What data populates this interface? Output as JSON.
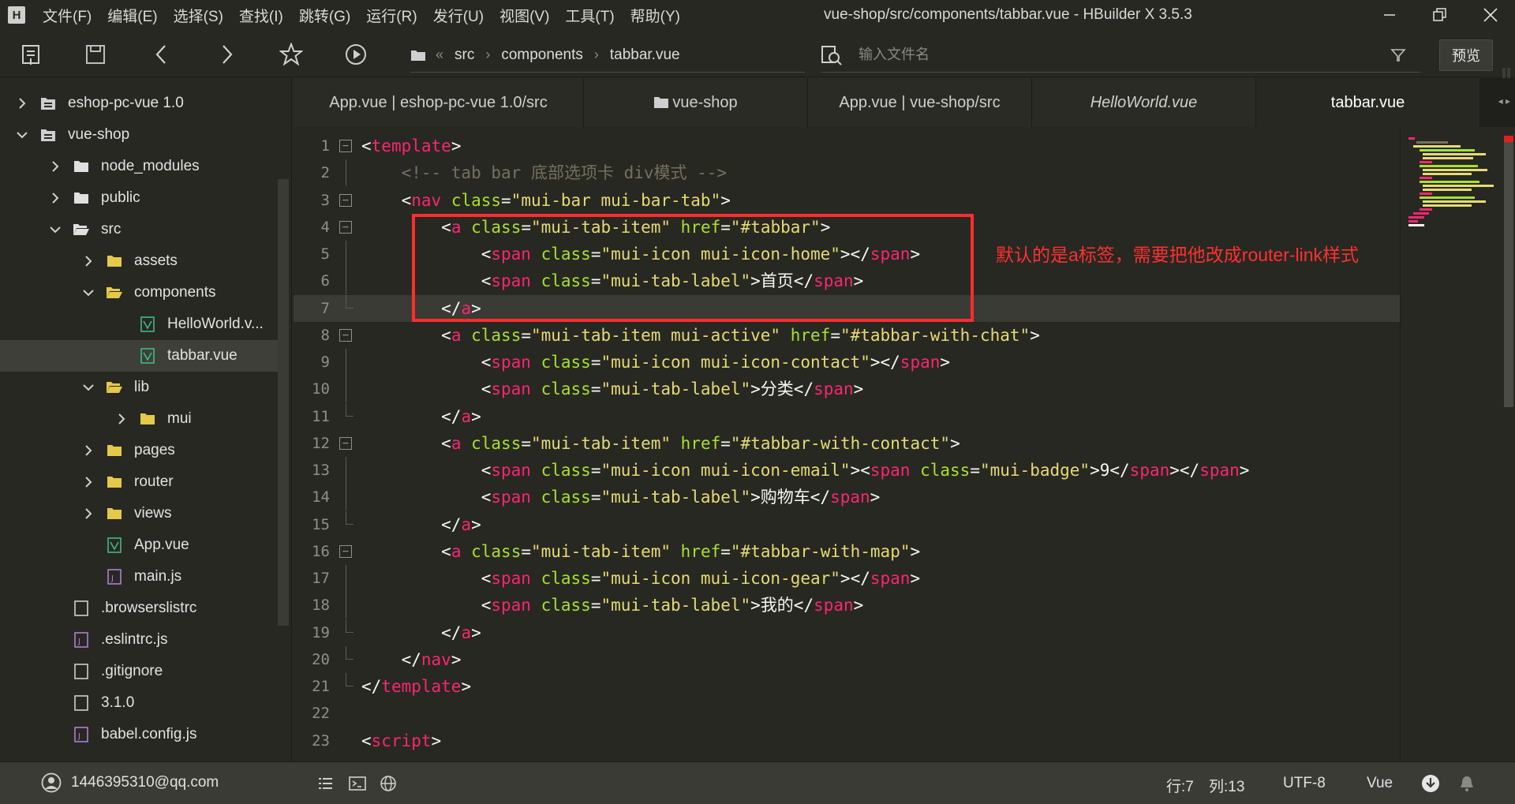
{
  "window": {
    "title": "vue-shop/src/components/tabbar.vue - HBuilder X 3.5.3"
  },
  "menu": [
    "文件(F)",
    "编辑(E)",
    "选择(S)",
    "查找(I)",
    "跳转(G)",
    "运行(R)",
    "发行(U)",
    "视图(V)",
    "工具(T)",
    "帮助(Y)"
  ],
  "breadcrumb": [
    "src",
    "components",
    "tabbar.vue"
  ],
  "search": {
    "placeholder": "输入文件名"
  },
  "toolbar": {
    "preview": "预览"
  },
  "sidebar": {
    "items": [
      {
        "label": "eshop-pc-vue 1.0"
      },
      {
        "label": "vue-shop"
      },
      {
        "label": "node_modules"
      },
      {
        "label": "public"
      },
      {
        "label": "src"
      },
      {
        "label": "assets"
      },
      {
        "label": "components"
      },
      {
        "label": "HelloWorld.v..."
      },
      {
        "label": "tabbar.vue"
      },
      {
        "label": "lib"
      },
      {
        "label": "mui"
      },
      {
        "label": "pages"
      },
      {
        "label": "router"
      },
      {
        "label": "views"
      },
      {
        "label": "App.vue"
      },
      {
        "label": "main.js"
      },
      {
        "label": ".browserslistrc"
      },
      {
        "label": ".eslintrc.js"
      },
      {
        "label": ".gitignore"
      },
      {
        "label": "3.1.0"
      },
      {
        "label": "babel.config.js"
      }
    ]
  },
  "tabs": [
    {
      "label": "App.vue | eshop-pc-vue 1.0/src"
    },
    {
      "label": "vue-shop"
    },
    {
      "label": "App.vue | vue-shop/src"
    },
    {
      "label": "HelloWorld.vue"
    },
    {
      "label": "tabbar.vue"
    }
  ],
  "editor": {
    "current_line": 7,
    "lines": [
      {
        "n": "1",
        "fold": "open",
        "tokens": [
          [
            "p",
            "<"
          ],
          [
            "t",
            "template"
          ],
          [
            "p",
            ">"
          ]
        ]
      },
      {
        "n": "2",
        "tokens": [
          [
            "s",
            "    "
          ],
          [
            "c",
            "<!-- tab bar 底部选项卡 div模式 -->"
          ]
        ]
      },
      {
        "n": "3",
        "fold": "open",
        "tokens": [
          [
            "s",
            "    "
          ],
          [
            "p",
            "<"
          ],
          [
            "t",
            "nav"
          ],
          [
            "s",
            " "
          ],
          [
            "a",
            "class"
          ],
          [
            "p",
            "="
          ],
          [
            "q",
            "\"mui-bar mui-bar-tab\""
          ],
          [
            "p",
            ">"
          ]
        ]
      },
      {
        "n": "4",
        "fold": "open",
        "tokens": [
          [
            "s",
            "        "
          ],
          [
            "p",
            "<"
          ],
          [
            "t",
            "a"
          ],
          [
            "s",
            " "
          ],
          [
            "a",
            "class"
          ],
          [
            "p",
            "="
          ],
          [
            "q",
            "\"mui-tab-item\""
          ],
          [
            "s",
            " "
          ],
          [
            "a",
            "href"
          ],
          [
            "p",
            "="
          ],
          [
            "q",
            "\"#tabbar\""
          ],
          [
            "p",
            ">"
          ]
        ]
      },
      {
        "n": "5",
        "tokens": [
          [
            "s",
            "            "
          ],
          [
            "p",
            "<"
          ],
          [
            "t",
            "span"
          ],
          [
            "s",
            " "
          ],
          [
            "a",
            "class"
          ],
          [
            "p",
            "="
          ],
          [
            "q",
            "\"mui-icon mui-icon-home\""
          ],
          [
            "p",
            "></"
          ],
          [
            "t",
            "span"
          ],
          [
            "p",
            ">"
          ]
        ]
      },
      {
        "n": "6",
        "tokens": [
          [
            "s",
            "            "
          ],
          [
            "p",
            "<"
          ],
          [
            "t",
            "span"
          ],
          [
            "s",
            " "
          ],
          [
            "a",
            "class"
          ],
          [
            "p",
            "="
          ],
          [
            "q",
            "\"mui-tab-label\""
          ],
          [
            "p",
            ">"
          ],
          [
            "x",
            "首页"
          ],
          [
            "p",
            "</"
          ],
          [
            "t",
            "span"
          ],
          [
            "p",
            ">"
          ]
        ]
      },
      {
        "n": "7",
        "fold": "end",
        "tokens": [
          [
            "s",
            "        "
          ],
          [
            "p",
            "</"
          ],
          [
            "t",
            "a"
          ],
          [
            "p",
            ">"
          ]
        ]
      },
      {
        "n": "8",
        "fold": "open",
        "tokens": [
          [
            "s",
            "        "
          ],
          [
            "p",
            "<"
          ],
          [
            "t",
            "a"
          ],
          [
            "s",
            " "
          ],
          [
            "a",
            "class"
          ],
          [
            "p",
            "="
          ],
          [
            "q",
            "\"mui-tab-item mui-active\""
          ],
          [
            "s",
            " "
          ],
          [
            "a",
            "href"
          ],
          [
            "p",
            "="
          ],
          [
            "q",
            "\"#tabbar-with-chat\""
          ],
          [
            "p",
            ">"
          ]
        ]
      },
      {
        "n": "9",
        "tokens": [
          [
            "s",
            "            "
          ],
          [
            "p",
            "<"
          ],
          [
            "t",
            "span"
          ],
          [
            "s",
            " "
          ],
          [
            "a",
            "class"
          ],
          [
            "p",
            "="
          ],
          [
            "q",
            "\"mui-icon mui-icon-contact\""
          ],
          [
            "p",
            "></"
          ],
          [
            "t",
            "span"
          ],
          [
            "p",
            ">"
          ]
        ]
      },
      {
        "n": "10",
        "tokens": [
          [
            "s",
            "            "
          ],
          [
            "p",
            "<"
          ],
          [
            "t",
            "span"
          ],
          [
            "s",
            " "
          ],
          [
            "a",
            "class"
          ],
          [
            "p",
            "="
          ],
          [
            "q",
            "\"mui-tab-label\""
          ],
          [
            "p",
            ">"
          ],
          [
            "x",
            "分类"
          ],
          [
            "p",
            "</"
          ],
          [
            "t",
            "span"
          ],
          [
            "p",
            ">"
          ]
        ]
      },
      {
        "n": "11",
        "fold": "end",
        "tokens": [
          [
            "s",
            "        "
          ],
          [
            "p",
            "</"
          ],
          [
            "t",
            "a"
          ],
          [
            "p",
            ">"
          ]
        ]
      },
      {
        "n": "12",
        "fold": "open",
        "tokens": [
          [
            "s",
            "        "
          ],
          [
            "p",
            "<"
          ],
          [
            "t",
            "a"
          ],
          [
            "s",
            " "
          ],
          [
            "a",
            "class"
          ],
          [
            "p",
            "="
          ],
          [
            "q",
            "\"mui-tab-item\""
          ],
          [
            "s",
            " "
          ],
          [
            "a",
            "href"
          ],
          [
            "p",
            "="
          ],
          [
            "q",
            "\"#tabbar-with-contact\""
          ],
          [
            "p",
            ">"
          ]
        ]
      },
      {
        "n": "13",
        "tokens": [
          [
            "s",
            "            "
          ],
          [
            "p",
            "<"
          ],
          [
            "t",
            "span"
          ],
          [
            "s",
            " "
          ],
          [
            "a",
            "class"
          ],
          [
            "p",
            "="
          ],
          [
            "q",
            "\"mui-icon mui-icon-email\""
          ],
          [
            "p",
            ">"
          ],
          [
            "p",
            "<"
          ],
          [
            "t",
            "span"
          ],
          [
            "s",
            " "
          ],
          [
            "a",
            "class"
          ],
          [
            "p",
            "="
          ],
          [
            "q",
            "\"mui-badge\""
          ],
          [
            "p",
            ">"
          ],
          [
            "x",
            "9"
          ],
          [
            "p",
            "</"
          ],
          [
            "t",
            "span"
          ],
          [
            "p",
            "></"
          ],
          [
            "t",
            "span"
          ],
          [
            "p",
            ">"
          ]
        ]
      },
      {
        "n": "14",
        "tokens": [
          [
            "s",
            "            "
          ],
          [
            "p",
            "<"
          ],
          [
            "t",
            "span"
          ],
          [
            "s",
            " "
          ],
          [
            "a",
            "class"
          ],
          [
            "p",
            "="
          ],
          [
            "q",
            "\"mui-tab-label\""
          ],
          [
            "p",
            ">"
          ],
          [
            "x",
            "购物车"
          ],
          [
            "p",
            "</"
          ],
          [
            "t",
            "span"
          ],
          [
            "p",
            ">"
          ]
        ]
      },
      {
        "n": "15",
        "fold": "end",
        "tokens": [
          [
            "s",
            "        "
          ],
          [
            "p",
            "</"
          ],
          [
            "t",
            "a"
          ],
          [
            "p",
            ">"
          ]
        ]
      },
      {
        "n": "16",
        "fold": "open",
        "tokens": [
          [
            "s",
            "        "
          ],
          [
            "p",
            "<"
          ],
          [
            "t",
            "a"
          ],
          [
            "s",
            " "
          ],
          [
            "a",
            "class"
          ],
          [
            "p",
            "="
          ],
          [
            "q",
            "\"mui-tab-item\""
          ],
          [
            "s",
            " "
          ],
          [
            "a",
            "href"
          ],
          [
            "p",
            "="
          ],
          [
            "q",
            "\"#tabbar-with-map\""
          ],
          [
            "p",
            ">"
          ]
        ]
      },
      {
        "n": "17",
        "tokens": [
          [
            "s",
            "            "
          ],
          [
            "p",
            "<"
          ],
          [
            "t",
            "span"
          ],
          [
            "s",
            " "
          ],
          [
            "a",
            "class"
          ],
          [
            "p",
            "="
          ],
          [
            "q",
            "\"mui-icon mui-icon-gear\""
          ],
          [
            "p",
            "></"
          ],
          [
            "t",
            "span"
          ],
          [
            "p",
            ">"
          ]
        ]
      },
      {
        "n": "18",
        "tokens": [
          [
            "s",
            "            "
          ],
          [
            "p",
            "<"
          ],
          [
            "t",
            "span"
          ],
          [
            "s",
            " "
          ],
          [
            "a",
            "class"
          ],
          [
            "p",
            "="
          ],
          [
            "q",
            "\"mui-tab-label\""
          ],
          [
            "p",
            ">"
          ],
          [
            "x",
            "我的"
          ],
          [
            "p",
            "</"
          ],
          [
            "t",
            "span"
          ],
          [
            "p",
            ">"
          ]
        ]
      },
      {
        "n": "19",
        "fold": "end",
        "tokens": [
          [
            "s",
            "        "
          ],
          [
            "p",
            "</"
          ],
          [
            "t",
            "a"
          ],
          [
            "p",
            ">"
          ]
        ]
      },
      {
        "n": "20",
        "fold": "end",
        "tokens": [
          [
            "s",
            "    "
          ],
          [
            "p",
            "</"
          ],
          [
            "t",
            "nav"
          ],
          [
            "p",
            ">"
          ]
        ]
      },
      {
        "n": "21",
        "fold": "end",
        "tokens": [
          [
            "p",
            "</"
          ],
          [
            "t",
            "template"
          ],
          [
            "p",
            ">"
          ]
        ]
      },
      {
        "n": "22",
        "tokens": []
      },
      {
        "n": "23",
        "tokens": [
          [
            "p",
            "<"
          ],
          [
            "t",
            "script"
          ],
          [
            "p",
            ">"
          ]
        ]
      }
    ]
  },
  "annotation": {
    "text": "默认的是a标签，需要把他改成router-link样式"
  },
  "status": {
    "account": "1446395310@qq.com",
    "line": "行:7",
    "column": "列:13",
    "encoding": "UTF-8",
    "language": "Vue"
  },
  "colors": {
    "background": "#272822",
    "tag": "#f92672",
    "attribute": "#a6e22e",
    "string": "#e6db74",
    "comment": "#75715e",
    "annotation": "#ff2d2d"
  }
}
